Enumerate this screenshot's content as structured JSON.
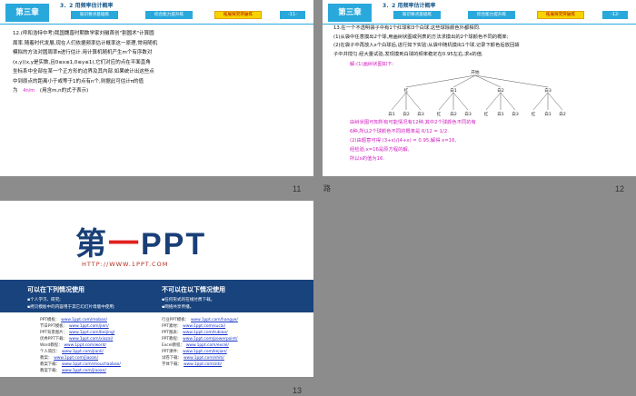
{
  "slide11": {
    "header": {
      "chapter": "第三章",
      "section": "3．2  用频率估计概率",
      "tabs": [
        "知识要点基础练",
        "综合能力提升练",
        "拓展探究突破练"
      ],
      "page": "-11-"
    },
    "text_lines": [
      "12.(呼和浩特中考)我国魏晋时期数学家刘徽首创\"割圆术\"计算圆",
      "周率.随着时代发展,现在人们依据频率估计概率这一原理,常用随机",
      "模拟的方法对圆周率π进行估计.用计算机随机产生m个有序数对",
      "(x,y)(x,y是实数,且0≤x≤1,0≤y≤1),它们对应的点在平面直角",
      "坐标系中全部在某一个正方形的边界及其内部.如果统计出这些点",
      "中到原点的距离小于或等于1的点有n个,则据此可估计π的值",
      "为",
      "(用含m,n的式子表示)"
    ],
    "answer": "4n/m",
    "slide_number": "11"
  },
  "slide12": {
    "header": {
      "chapter": "第三章",
      "section": "3．2  用频率估计概率",
      "tabs": [
        "知识要点基础练",
        "综合能力提升练",
        "拓展探究突破练"
      ],
      "page": "-12-"
    },
    "question_lines": [
      "13.在一个不透明袋子中有1个红球和3个白球,这些球除颜色外都相同.",
      "(1)从袋中任意摸出2个球,用画树状图或列表的方法求摸出的2个球颜色不同的概率;",
      "(2)在袋子中再放入x个白球后,进行如下实验:从袋中随机摸出1个球,记录下颜色后放回袋",
      "子中并搅匀.经大量试验,发现摸到白球的频率稳定在0.95左右,求x的值."
    ],
    "solution_title": "解:(1)画树状图如下:",
    "tree": {
      "root": "开始",
      "level1": [
        "红",
        "白1",
        "白2",
        "白3"
      ],
      "level2": [
        [
          "白1",
          "白2",
          "白3"
        ],
        [
          "红",
          "白2",
          "白3"
        ],
        [
          "红",
          "白1",
          "白3"
        ],
        [
          "红",
          "白1",
          "白2"
        ]
      ]
    },
    "solution_lines": [
      "由树状图可知所有可能情况有12种,其中2个球颜色不同的有",
      "6种,所以2个球颜色不同的概率是 6/12 = 1/2.",
      "(2)由题意可得 (3+x)/(4+x) = 0.95,解得 x=16,",
      "经检验,x=16是原方程的解,",
      "所以x的值为16."
    ],
    "slide_number": "12"
  },
  "slide13": {
    "logo_main": "第",
    "logo_dash": "一",
    "logo_tail": "PPT",
    "url": "HTTP://WWW.1PPT.COM",
    "left_heading": "可以在下列情况使用",
    "left_items": [
      "个人学习、研究;",
      "拷贝模板中的内容用于其它幻灯片母版中使用;"
    ],
    "right_heading": "不可以在以下情况使用",
    "right_items": [
      "任何形式的在线付费下载。",
      "网络共享传播。"
    ],
    "links_left": [
      {
        "label": "PPT模板：",
        "url": "www.1ppt.com/moban/"
      },
      {
        "label": "节日PPT模板：",
        "url": "www.1ppt.com/jieri/"
      },
      {
        "label": "PPT背景图片：",
        "url": "www.1ppt.com/beijing/"
      },
      {
        "label": "优秀PPT下载：",
        "url": "www.1ppt.com/xiazai/"
      },
      {
        "label": "Word教程：",
        "url": "www.1ppt.com/word/"
      },
      {
        "label": "个人简历：",
        "url": "www.1ppt.com/jianli/"
      },
      {
        "label": "教案：",
        "url": "www.1ppt.com/jiaoan/"
      },
      {
        "label": "教案下载：",
        "url": "www.1ppt.com/shouchaobao/"
      },
      {
        "label": "教案下载：",
        "url": "www.1ppt.com/jiaoan/"
      }
    ],
    "links_right": [
      {
        "label": "行业PPT模板：",
        "url": "www.1ppt.com/hangye/"
      },
      {
        "label": "PPT素材：",
        "url": "www.1ppt.com/sucai/"
      },
      {
        "label": "PPT图表：",
        "url": "www.1ppt.com/tubiao/"
      },
      {
        "label": "PPT教程：",
        "url": "www.1ppt.com/powerpoint/"
      },
      {
        "label": "Excel教程：",
        "url": "www.1ppt.com/excel/"
      },
      {
        "label": "PPT课件：",
        "url": "www.1ppt.com/kejian/"
      },
      {
        "label": "试卷下载：",
        "url": "www.1ppt.com/shiti/"
      },
      {
        "label": "字体下载：",
        "url": "www.1ppt.com/ziti/"
      }
    ],
    "slide_number": "13"
  },
  "stray_text": "路",
  "colors": {
    "header_blue": "#29a8dc",
    "active_tab": "#f6d400",
    "solution_magenta": "#d020c0",
    "band_navy": "#18437d",
    "logo_blue": "#1a3f77",
    "logo_red": "#e02020"
  }
}
